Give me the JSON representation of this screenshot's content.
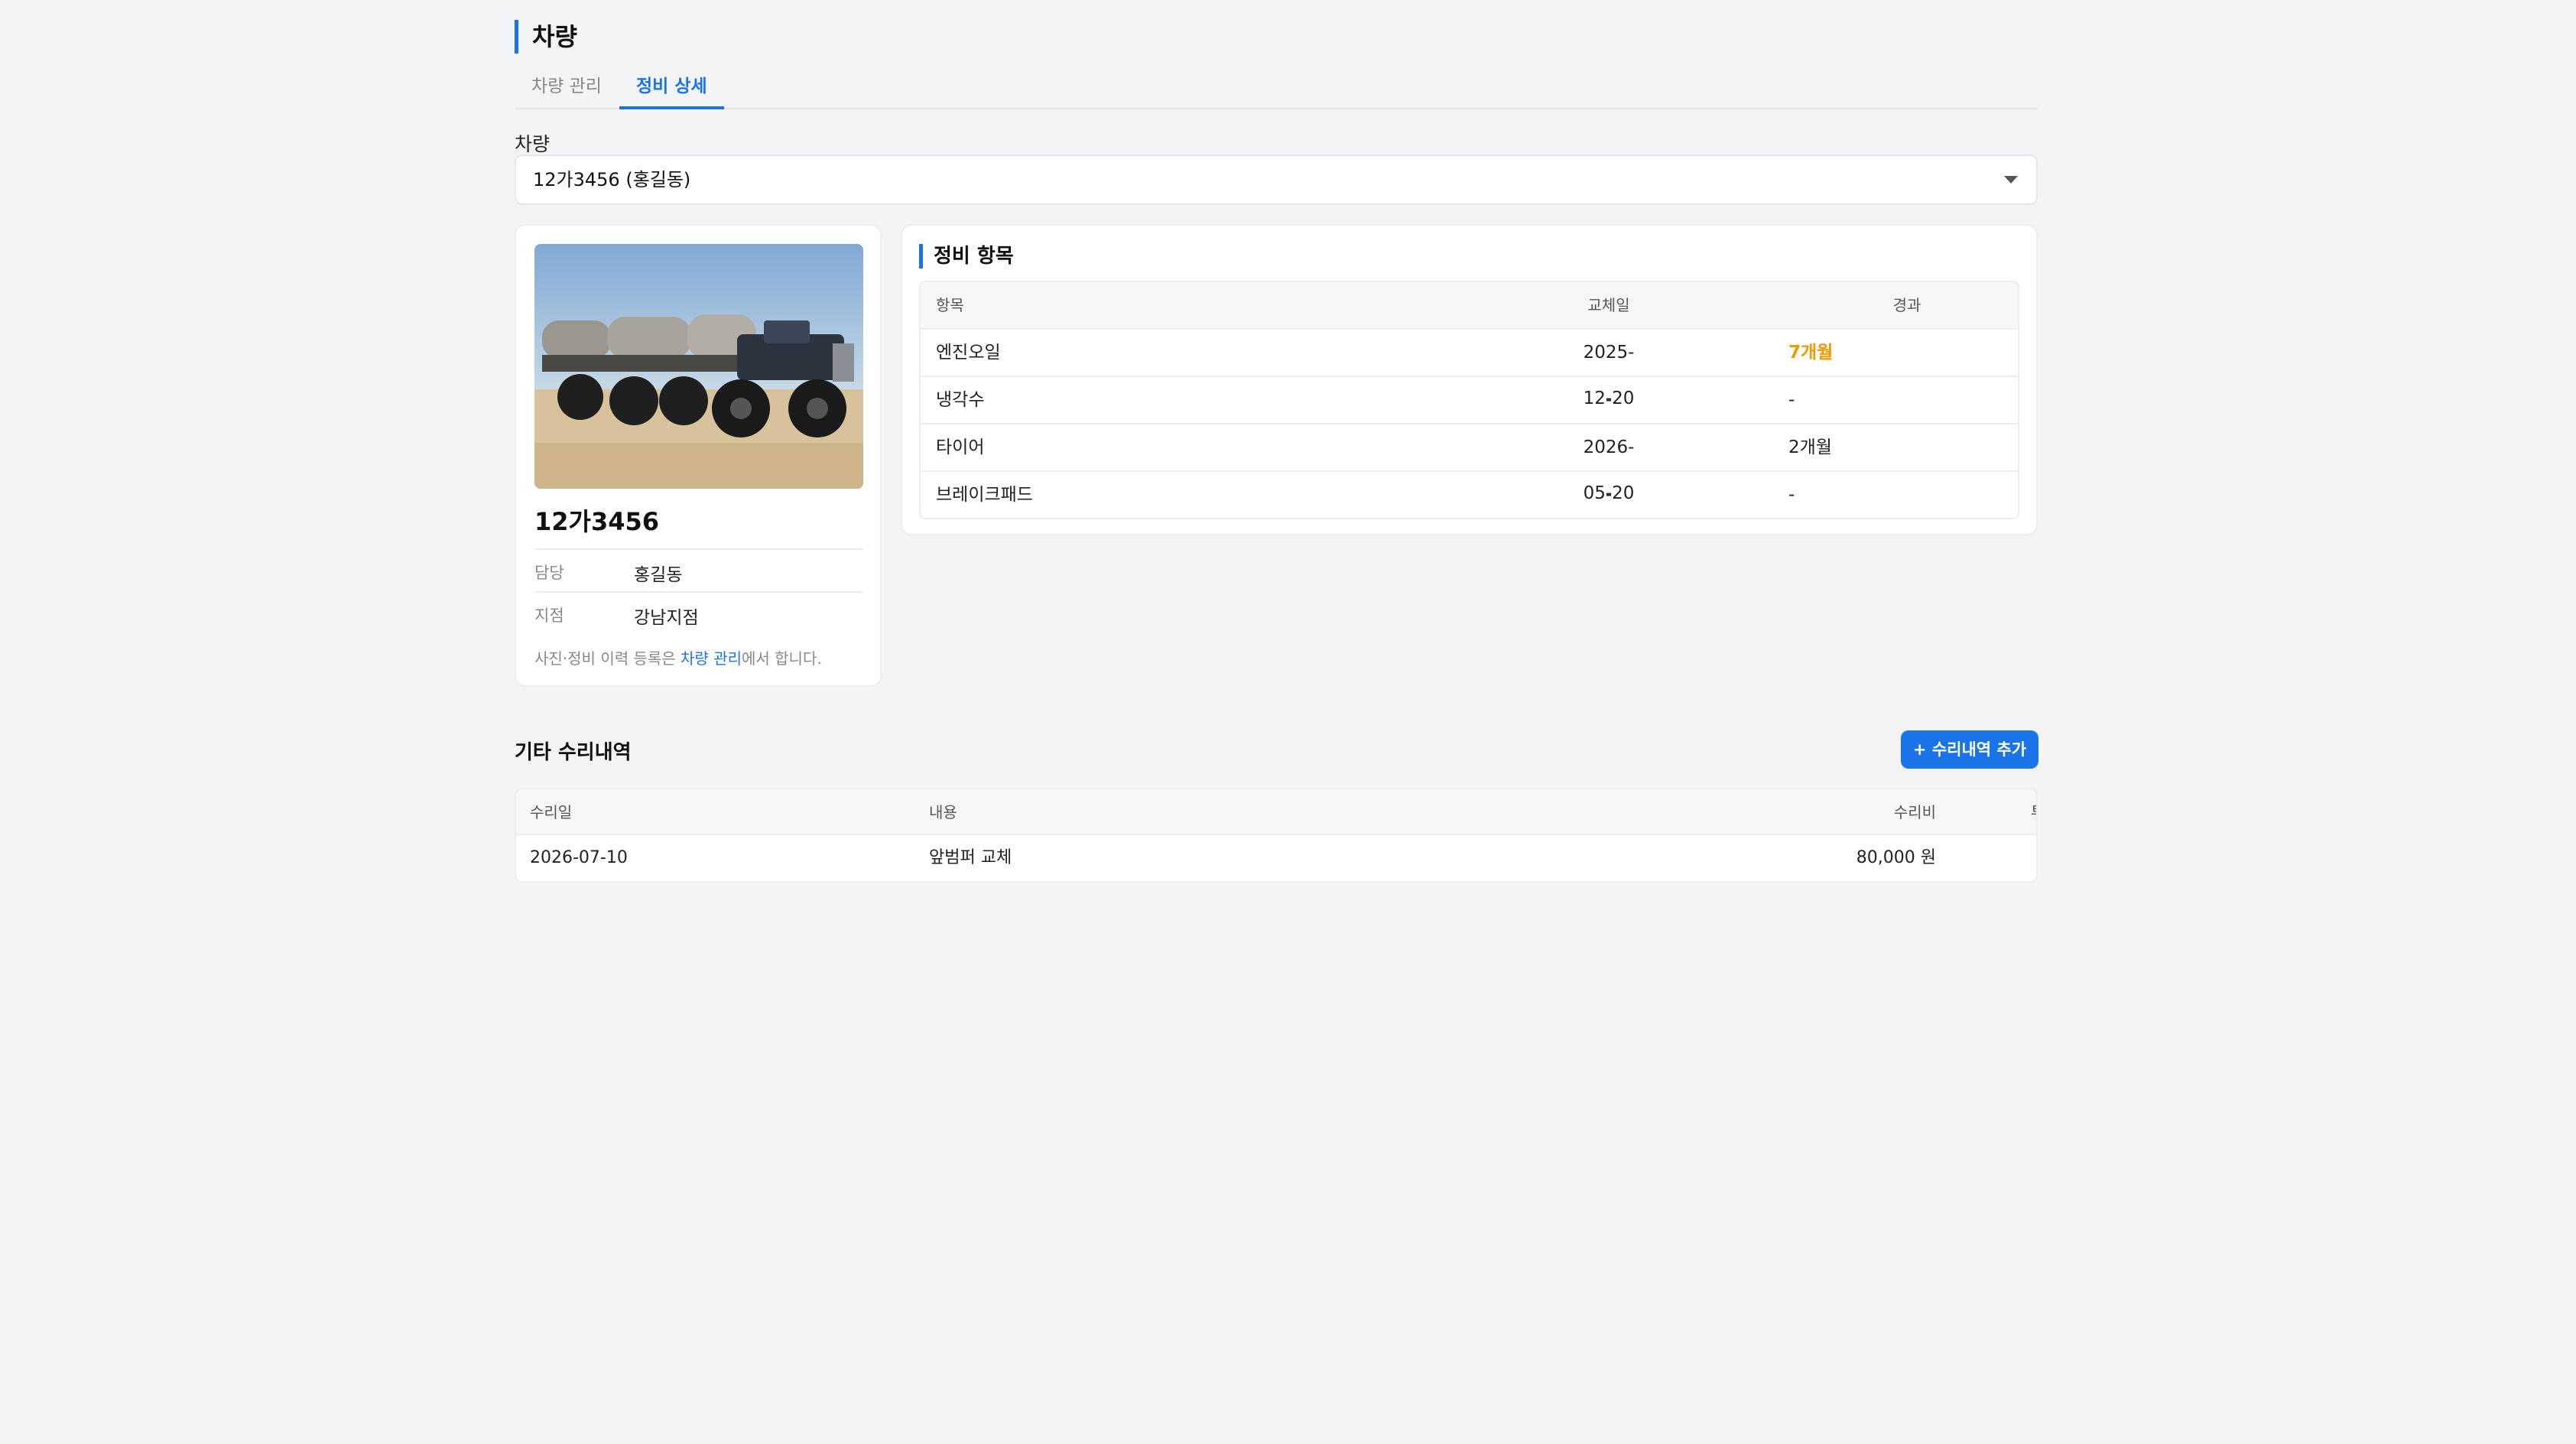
{
  "page": {
    "title": "차량"
  },
  "tabs": [
    {
      "label": "차량 관리",
      "active": false
    },
    {
      "label": "정비 상세",
      "active": true
    }
  ],
  "vehicle_select": {
    "label": "차량",
    "value": "12가3456 (홍길동)"
  },
  "vehicle_card": {
    "number": "12가3456",
    "manager_label": "담당",
    "manager": "홍길동",
    "branch_label": "지점",
    "branch": "강남지점",
    "note_prefix": "사진·정비 이력 등록은 ",
    "note_link": "차량 관리",
    "note_suffix": "에서 합니다."
  },
  "maintenance": {
    "title": "정비 항목",
    "headers": {
      "item": "항목",
      "date": "교체일",
      "elapsed": "경과"
    },
    "rows": [
      {
        "item": "엔진오일",
        "date": "2025-12-20",
        "elapsed": "7개월",
        "warn": true
      },
      {
        "item": "냉각수",
        "date": "-",
        "elapsed": "-",
        "warn": false
      },
      {
        "item": "타이어",
        "date": "2026-05-20",
        "elapsed": "2개월",
        "warn": false
      },
      {
        "item": "브레이크패드",
        "date": "-",
        "elapsed": "-",
        "warn": false
      }
    ]
  },
  "repairs": {
    "title": "기타 수리내역",
    "add_button": "+ 수리내역 추가",
    "headers": {
      "date": "수리일",
      "content": "내용",
      "cost": "수리비",
      "investor": "투자자 입금"
    },
    "rows": [
      {
        "date": "2026-07-10",
        "content": "앞범퍼 교체",
        "cost": "80,000 원",
        "investor": "-"
      }
    ]
  },
  "colors": {
    "accent": "#1a73e8",
    "warning": "#f29900",
    "background": "#f3f4f6"
  }
}
